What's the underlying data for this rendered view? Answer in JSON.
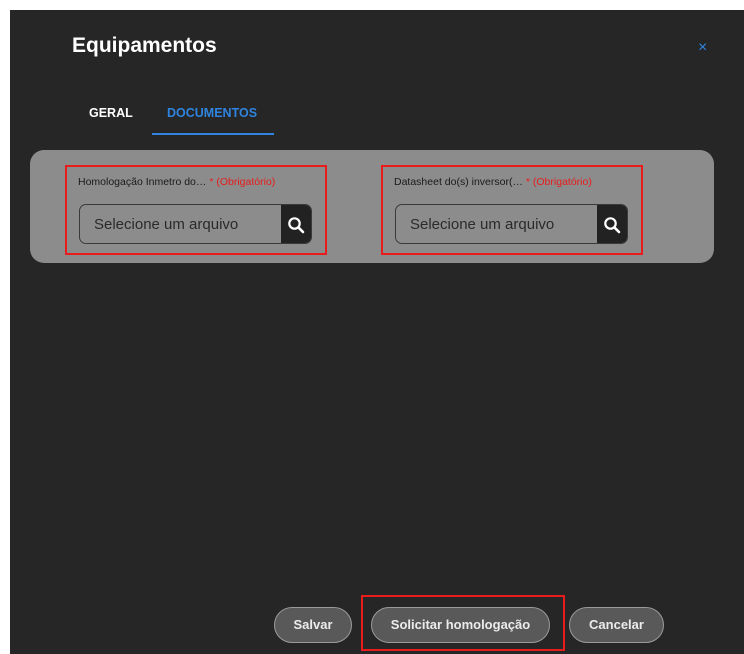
{
  "dialog": {
    "title": "Equipamentos",
    "close_label": "×"
  },
  "tabs": [
    {
      "label": "GERAL",
      "active": false
    },
    {
      "label": "DOCUMENTOS",
      "active": true
    }
  ],
  "fields": [
    {
      "label": "Homologação Inmetro do…",
      "required_label": "* (Obrigatório)",
      "placeholder": "Selecione um arquivo",
      "icon": "search-icon"
    },
    {
      "label": "Datasheet do(s) inversor(…",
      "required_label": "* (Obrigatório)",
      "placeholder": "Selecione um arquivo",
      "icon": "search-icon"
    }
  ],
  "buttons": {
    "save": "Salvar",
    "request_homologation": "Solicitar homologação",
    "cancel": "Cancelar"
  },
  "colors": {
    "accent": "#2f84e0",
    "highlight": "#e81c1c",
    "dialog_bg": "#262626",
    "panel_bg": "#8c8c8c"
  }
}
